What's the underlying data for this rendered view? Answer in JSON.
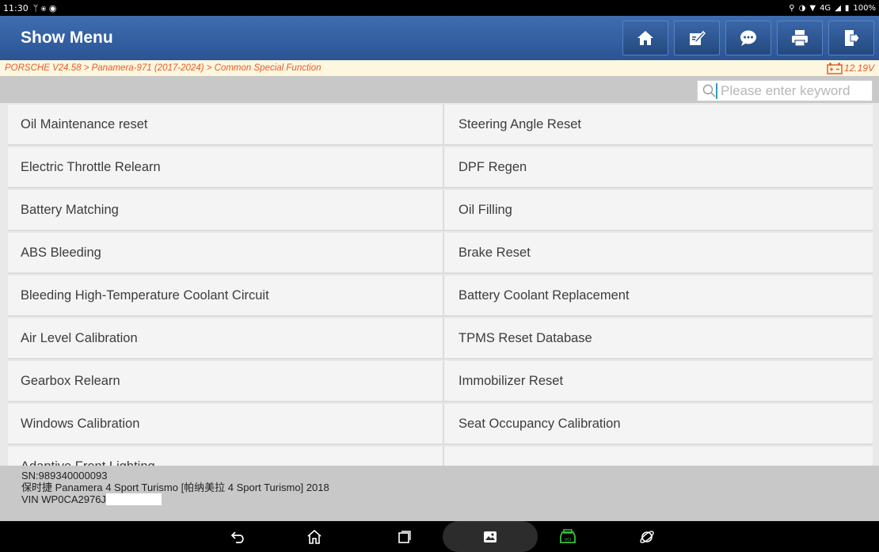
{
  "status": {
    "time": "11:30",
    "network": "4G",
    "battery": "100%"
  },
  "header": {
    "title": "Show Menu",
    "buttons": [
      {
        "name": "home-icon"
      },
      {
        "name": "edit-icon"
      },
      {
        "name": "chat-icon"
      },
      {
        "name": "print-icon"
      },
      {
        "name": "exit-icon"
      }
    ]
  },
  "breadcrumb": "PORSCHE V24.58 > Panamera-971 (2017-2024) > Common Special Function",
  "voltage": "12.19V",
  "search": {
    "placeholder": "Please enter keyword",
    "value": ""
  },
  "menu": [
    {
      "left": "Oil Maintenance reset",
      "right": "Steering Angle Reset"
    },
    {
      "left": "Electric Throttle Relearn",
      "right": "DPF Regen"
    },
    {
      "left": "Battery Matching",
      "right": "Oil Filling"
    },
    {
      "left": "ABS Bleeding",
      "right": "Brake Reset"
    },
    {
      "left": "Bleeding High-Temperature Coolant Circuit",
      "right": "Battery Coolant Replacement"
    },
    {
      "left": "Air Level Calibration",
      "right": "TPMS Reset Database"
    },
    {
      "left": "Gearbox Relearn",
      "right": "Immobilizer Reset"
    },
    {
      "left": "Windows Calibration",
      "right": "Seat Occupancy Calibration"
    },
    {
      "left": "Adaptive Front Lighting",
      "right": ""
    }
  ],
  "footer": {
    "sn": "SN:989340000093",
    "vehicle": "保时捷 Panamera 4 Sport Turismo [帕纳美拉 4 Sport Turismo] 2018",
    "vin": "VIN WP0CA2976J"
  },
  "colors": {
    "header": "#2f5b9c",
    "accent": "#e85b25",
    "vci": "#3fbf3f"
  }
}
